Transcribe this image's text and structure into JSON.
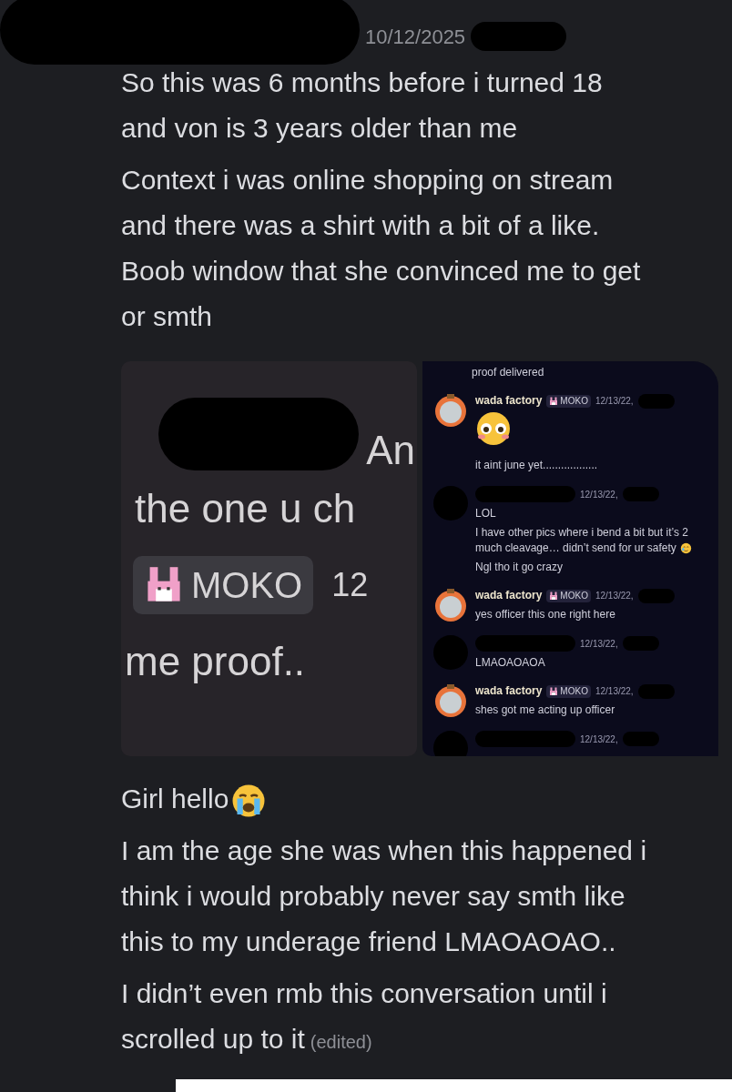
{
  "header": {
    "date": "10/12/2025"
  },
  "top_paragraphs": [
    {
      "kind": "text",
      "text": "So this was 6 months before i turned 18\nand von is 3 years older than me"
    },
    {
      "kind": "text",
      "text": "Context i was online shopping on stream\nand there was a shirt with a bit of a like.\nBoob window that she convinced me to get\nor smth"
    }
  ],
  "attachments": [
    {
      "kind": "zoom",
      "line_1": "An",
      "line_2": "the one u ch",
      "tag": "MOKO",
      "time": "12",
      "line_3": "me proof.."
    },
    {
      "kind": "chat",
      "top_text": "proof delivered",
      "messages": [
        {
          "kind": "author",
          "author": "wada factory",
          "tag": "MOKO",
          "time": "12/13/22,",
          "lines": [
            {
              "kind": "emoji"
            }
          ]
        },
        {
          "kind": "continuation",
          "lines": [
            {
              "kind": "text",
              "text": "it aint june yet.................."
            }
          ]
        },
        {
          "kind": "redacted",
          "time": "12/13/22,",
          "lines": [
            {
              "kind": "text",
              "text": "LOL"
            },
            {
              "kind": "text_emoji",
              "text": "I have other pics where i bend a bit but it’s 2 much cleavage… didn’t send for ur safety"
            },
            {
              "kind": "text",
              "text": "Ngl tho it go crazy"
            }
          ]
        },
        {
          "kind": "author",
          "author": "wada factory",
          "tag": "MOKO",
          "time": "12/13/22,",
          "lines": [
            {
              "kind": "text",
              "text": "yes officer this one right here"
            }
          ]
        },
        {
          "kind": "redacted",
          "time": "12/13/22,",
          "lines": [
            {
              "kind": "text",
              "text": "LMAOAOAOA"
            }
          ]
        },
        {
          "kind": "author",
          "author": "wada factory",
          "tag": "MOKO",
          "time": "12/13/22,",
          "lines": [
            {
              "kind": "text",
              "text": "shes got me acting up officer"
            }
          ]
        },
        {
          "kind": "redacted",
          "time": "12/13/22,"
        }
      ]
    }
  ],
  "bottom_paragraphs": [
    {
      "kind": "text_emoji",
      "text": "Girl hello"
    },
    {
      "kind": "text",
      "text": "I am the age she was when this happened i\nthink i would probably never say smth like\nthis to my underage friend LMAOAOAO.."
    },
    {
      "kind": "text",
      "text": "I didn’t even rmb this conversation until i\nscrolled up to it",
      "edited": "(edited)"
    }
  ]
}
